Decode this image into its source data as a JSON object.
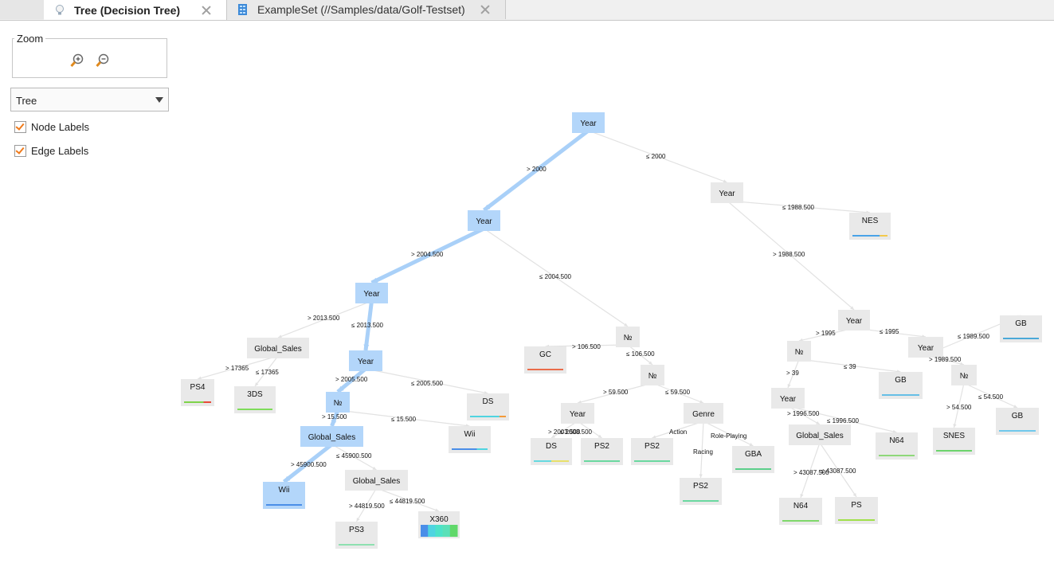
{
  "tabs": [
    {
      "label": "Tree (Decision Tree)",
      "active": true,
      "icon": "lightbulb-icon"
    },
    {
      "label": "ExampleSet (//Samples/data/Golf-Testset)",
      "active": false,
      "icon": "table-icon"
    }
  ],
  "left_panel": {
    "zoom_label": "Zoom",
    "zoom_in_icon": "zoom-in-icon",
    "zoom_out_icon": "zoom-out-icon",
    "view_mode": "Tree",
    "node_labels": {
      "label": "Node Labels",
      "checked": true
    },
    "edge_labels": {
      "label": "Edge Labels",
      "checked": true
    }
  },
  "colors": {
    "selected_node": "#b3d6fa",
    "node": "#e9e9e9",
    "edge": "#e2e2e2",
    "selected_edge": "#a9d0f8",
    "checkbox_accent": "#f07a1a"
  },
  "tree": {
    "nodes": [
      {
        "id": "n1",
        "label": "Year",
        "selected": true,
        "leaf": false
      },
      {
        "id": "n2",
        "label": "Year",
        "selected": true,
        "leaf": false
      },
      {
        "id": "n3",
        "label": "Year",
        "selected": false,
        "leaf": false
      },
      {
        "id": "n4",
        "label": "Year",
        "selected": true,
        "leaf": false
      },
      {
        "id": "n5",
        "label": "№",
        "selected": false,
        "leaf": false
      },
      {
        "id": "n6",
        "label": "NES",
        "selected": false,
        "leaf": true,
        "bar": [
          {
            "c": "#4aa3e8",
            "w": 0.78
          },
          {
            "c": "#f2c94c",
            "w": 0.22
          }
        ]
      },
      {
        "id": "n7",
        "label": "Year",
        "selected": false,
        "leaf": false
      },
      {
        "id": "n8",
        "label": "Global_Sales",
        "selected": false,
        "leaf": false
      },
      {
        "id": "n9",
        "label": "Year",
        "selected": true,
        "leaf": false
      },
      {
        "id": "n10",
        "label": "GC",
        "selected": false,
        "leaf": true,
        "bar": [
          {
            "c": "#ea6b4a",
            "w": 1
          }
        ]
      },
      {
        "id": "n11",
        "label": "№",
        "selected": false,
        "leaf": false
      },
      {
        "id": "n12",
        "label": "№",
        "selected": false,
        "leaf": false
      },
      {
        "id": "n13",
        "label": "Year",
        "selected": false,
        "leaf": false
      },
      {
        "id": "n14",
        "label": "GB",
        "selected": false,
        "leaf": true,
        "bar": [
          {
            "c": "#66bfe6",
            "w": 1
          }
        ]
      },
      {
        "id": "n15",
        "label": "PS4",
        "selected": false,
        "leaf": true,
        "bar": [
          {
            "c": "#7fd34a",
            "w": 0.72
          },
          {
            "c": "#e84a3a",
            "w": 0.28
          }
        ]
      },
      {
        "id": "n16",
        "label": "3DS",
        "selected": false,
        "leaf": true,
        "bar": [
          {
            "c": "#7fdc5a",
            "w": 1
          }
        ]
      },
      {
        "id": "n17",
        "label": "№",
        "selected": true,
        "leaf": false
      },
      {
        "id": "n18",
        "label": "DS",
        "selected": false,
        "leaf": true,
        "bar": [
          {
            "c": "#4fd4e0",
            "w": 0.82
          },
          {
            "c": "#f29a3a",
            "w": 0.18
          }
        ]
      },
      {
        "id": "n19",
        "label": "Year",
        "selected": false,
        "leaf": false
      },
      {
        "id": "n20",
        "label": "Genre",
        "selected": false,
        "leaf": false
      },
      {
        "id": "n21",
        "label": "Year",
        "selected": false,
        "leaf": false
      },
      {
        "id": "n22",
        "label": "GB",
        "selected": false,
        "leaf": true,
        "bar": [
          {
            "c": "#4aa8d8",
            "w": 1
          }
        ]
      },
      {
        "id": "n23",
        "label": "№",
        "selected": false,
        "leaf": false
      },
      {
        "id": "n24",
        "label": "GB",
        "selected": false,
        "leaf": true,
        "bar": [
          {
            "c": "#70c8ec",
            "w": 1
          }
        ]
      },
      {
        "id": "n25",
        "label": "Global_Sales",
        "selected": true,
        "leaf": false
      },
      {
        "id": "n26",
        "label": "Wii",
        "selected": false,
        "leaf": true,
        "bar": [
          {
            "c": "#4a8ee8",
            "w": 0.7
          },
          {
            "c": "#4fd4e0",
            "w": 0.3
          }
        ]
      },
      {
        "id": "n27",
        "label": "DS",
        "selected": false,
        "leaf": true,
        "bar": [
          {
            "c": "#66d9e0",
            "w": 0.5
          },
          {
            "c": "#e8e06a",
            "w": 0.5
          }
        ]
      },
      {
        "id": "n28",
        "label": "PS2",
        "selected": false,
        "leaf": true,
        "bar": [
          {
            "c": "#6ad8a0",
            "w": 1
          }
        ]
      },
      {
        "id": "n29",
        "label": "PS2",
        "selected": false,
        "leaf": true,
        "bar": [
          {
            "c": "#6ad8a0",
            "w": 1
          }
        ]
      },
      {
        "id": "n30",
        "label": "GBA",
        "selected": false,
        "leaf": true,
        "bar": [
          {
            "c": "#5ccf8a",
            "w": 1
          }
        ]
      },
      {
        "id": "n31",
        "label": "Global_Sales",
        "selected": false,
        "leaf": false
      },
      {
        "id": "n32",
        "label": "N64",
        "selected": false,
        "leaf": true,
        "bar": [
          {
            "c": "#8fd87a",
            "w": 1
          }
        ]
      },
      {
        "id": "n33",
        "label": "SNES",
        "selected": false,
        "leaf": true,
        "bar": [
          {
            "c": "#6cd46c",
            "w": 1
          }
        ]
      },
      {
        "id": "n34",
        "label": "GB",
        "selected": false,
        "leaf": true,
        "bar": [
          {
            "c": "#7fd0ea",
            "w": 1
          }
        ]
      },
      {
        "id": "n35",
        "label": "Wii",
        "selected": true,
        "leaf": true,
        "bar": [
          {
            "c": "#4a8ee8",
            "w": 1
          }
        ]
      },
      {
        "id": "n36",
        "label": "Global_Sales",
        "selected": false,
        "leaf": false
      },
      {
        "id": "n37",
        "label": "PS2",
        "selected": false,
        "leaf": true,
        "bar": [
          {
            "c": "#6ad8a0",
            "w": 1
          }
        ]
      },
      {
        "id": "n38",
        "label": "N64",
        "selected": false,
        "leaf": true,
        "bar": [
          {
            "c": "#7fd86a",
            "w": 1
          }
        ]
      },
      {
        "id": "n39",
        "label": "PS",
        "selected": false,
        "leaf": true,
        "bar": [
          {
            "c": "#a0e04a",
            "w": 1
          }
        ]
      },
      {
        "id": "n40",
        "label": "PS3",
        "selected": false,
        "leaf": true,
        "bar": [
          {
            "c": "#8ee0b0",
            "w": 1
          }
        ]
      },
      {
        "id": "n41",
        "label": "X360",
        "selected": false,
        "leaf": true,
        "stack": [
          "#4a8ee8",
          "#4fd4e0",
          "#4de2c8",
          "#5ae0b8",
          "#60d86a"
        ]
      }
    ],
    "edges": [
      {
        "from": "n1",
        "to": "n2",
        "label": "> 2000",
        "selected": true
      },
      {
        "from": "n1",
        "to": "n3",
        "label": "≤ 2000",
        "selected": false
      },
      {
        "from": "n2",
        "to": "n4",
        "label": "> 2004.500",
        "selected": true
      },
      {
        "from": "n2",
        "to": "n5",
        "label": "≤ 2004.500",
        "selected": false
      },
      {
        "from": "n3",
        "to": "n6",
        "label": "≤ 1988.500",
        "selected": false
      },
      {
        "from": "n3",
        "to": "n7",
        "label": "> 1988.500",
        "selected": false
      },
      {
        "from": "n4",
        "to": "n8",
        "label": "> 2013.500",
        "selected": false
      },
      {
        "from": "n4",
        "to": "n9",
        "label": "≤ 2013.500",
        "selected": true
      },
      {
        "from": "n5",
        "to": "n10",
        "label": "> 106.500",
        "selected": false
      },
      {
        "from": "n5",
        "to": "n11",
        "label": "≤ 106.500",
        "selected": false
      },
      {
        "from": "n7",
        "to": "n12",
        "label": "> 1995",
        "selected": false
      },
      {
        "from": "n7",
        "to": "n13",
        "label": "≤ 1995",
        "selected": false
      },
      {
        "from": "n8",
        "to": "n15",
        "label": "> 17365",
        "selected": false
      },
      {
        "from": "n8",
        "to": "n16",
        "label": "≤ 17365",
        "selected": false
      },
      {
        "from": "n9",
        "to": "n17",
        "label": "> 2005.500",
        "selected": true
      },
      {
        "from": "n9",
        "to": "n18",
        "label": "≤ 2005.500",
        "selected": false
      },
      {
        "from": "n11",
        "to": "n19",
        "label": "> 59.500",
        "selected": false
      },
      {
        "from": "n11",
        "to": "n20",
        "label": "≤ 59.500",
        "selected": false
      },
      {
        "from": "n12",
        "to": "n21",
        "label": "> 39",
        "selected": false
      },
      {
        "from": "n12",
        "to": "n14",
        "label": "≤ 39",
        "selected": false
      },
      {
        "from": "n13",
        "to": "n22",
        "label": "≤ 1989.500",
        "selected": false
      },
      {
        "from": "n13",
        "to": "n23",
        "label": "> 1989.500",
        "selected": false
      },
      {
        "from": "n17",
        "to": "n25",
        "label": "> 15.500",
        "selected": true
      },
      {
        "from": "n17",
        "to": "n26",
        "label": "≤ 15.500",
        "selected": false
      },
      {
        "from": "n19",
        "to": "n27",
        "label": "> 2003.500",
        "selected": false
      },
      {
        "from": "n19",
        "to": "n28",
        "label": "≤ 2003.500",
        "selected": false
      },
      {
        "from": "n20",
        "to": "n29",
        "label": "Action",
        "selected": false
      },
      {
        "from": "n20",
        "to": "n37",
        "label": "Racing",
        "selected": false
      },
      {
        "from": "n20",
        "to": "n30",
        "label": "Role-Playing",
        "selected": false
      },
      {
        "from": "n21",
        "to": "n31",
        "label": "> 1996.500",
        "selected": false
      },
      {
        "from": "n21",
        "to": "n32",
        "label": "≤ 1996.500",
        "selected": false
      },
      {
        "from": "n23",
        "to": "n33",
        "label": "> 54.500",
        "selected": false
      },
      {
        "from": "n23",
        "to": "n24",
        "label": "≤ 54.500",
        "selected": false
      },
      {
        "from": "n25",
        "to": "n35",
        "label": "> 45900.500",
        "selected": true
      },
      {
        "from": "n25",
        "to": "n36",
        "label": "≤ 45900.500",
        "selected": false
      },
      {
        "from": "n31",
        "to": "n38",
        "label": "> 43087.500",
        "selected": false
      },
      {
        "from": "n31",
        "to": "n39",
        "label": "≤ 43087.500",
        "selected": false
      },
      {
        "from": "n36",
        "to": "n40",
        "label": "> 44819.500",
        "selected": false
      },
      {
        "from": "n36",
        "to": "n41",
        "label": "≤ 44819.500",
        "selected": false
      }
    ]
  }
}
